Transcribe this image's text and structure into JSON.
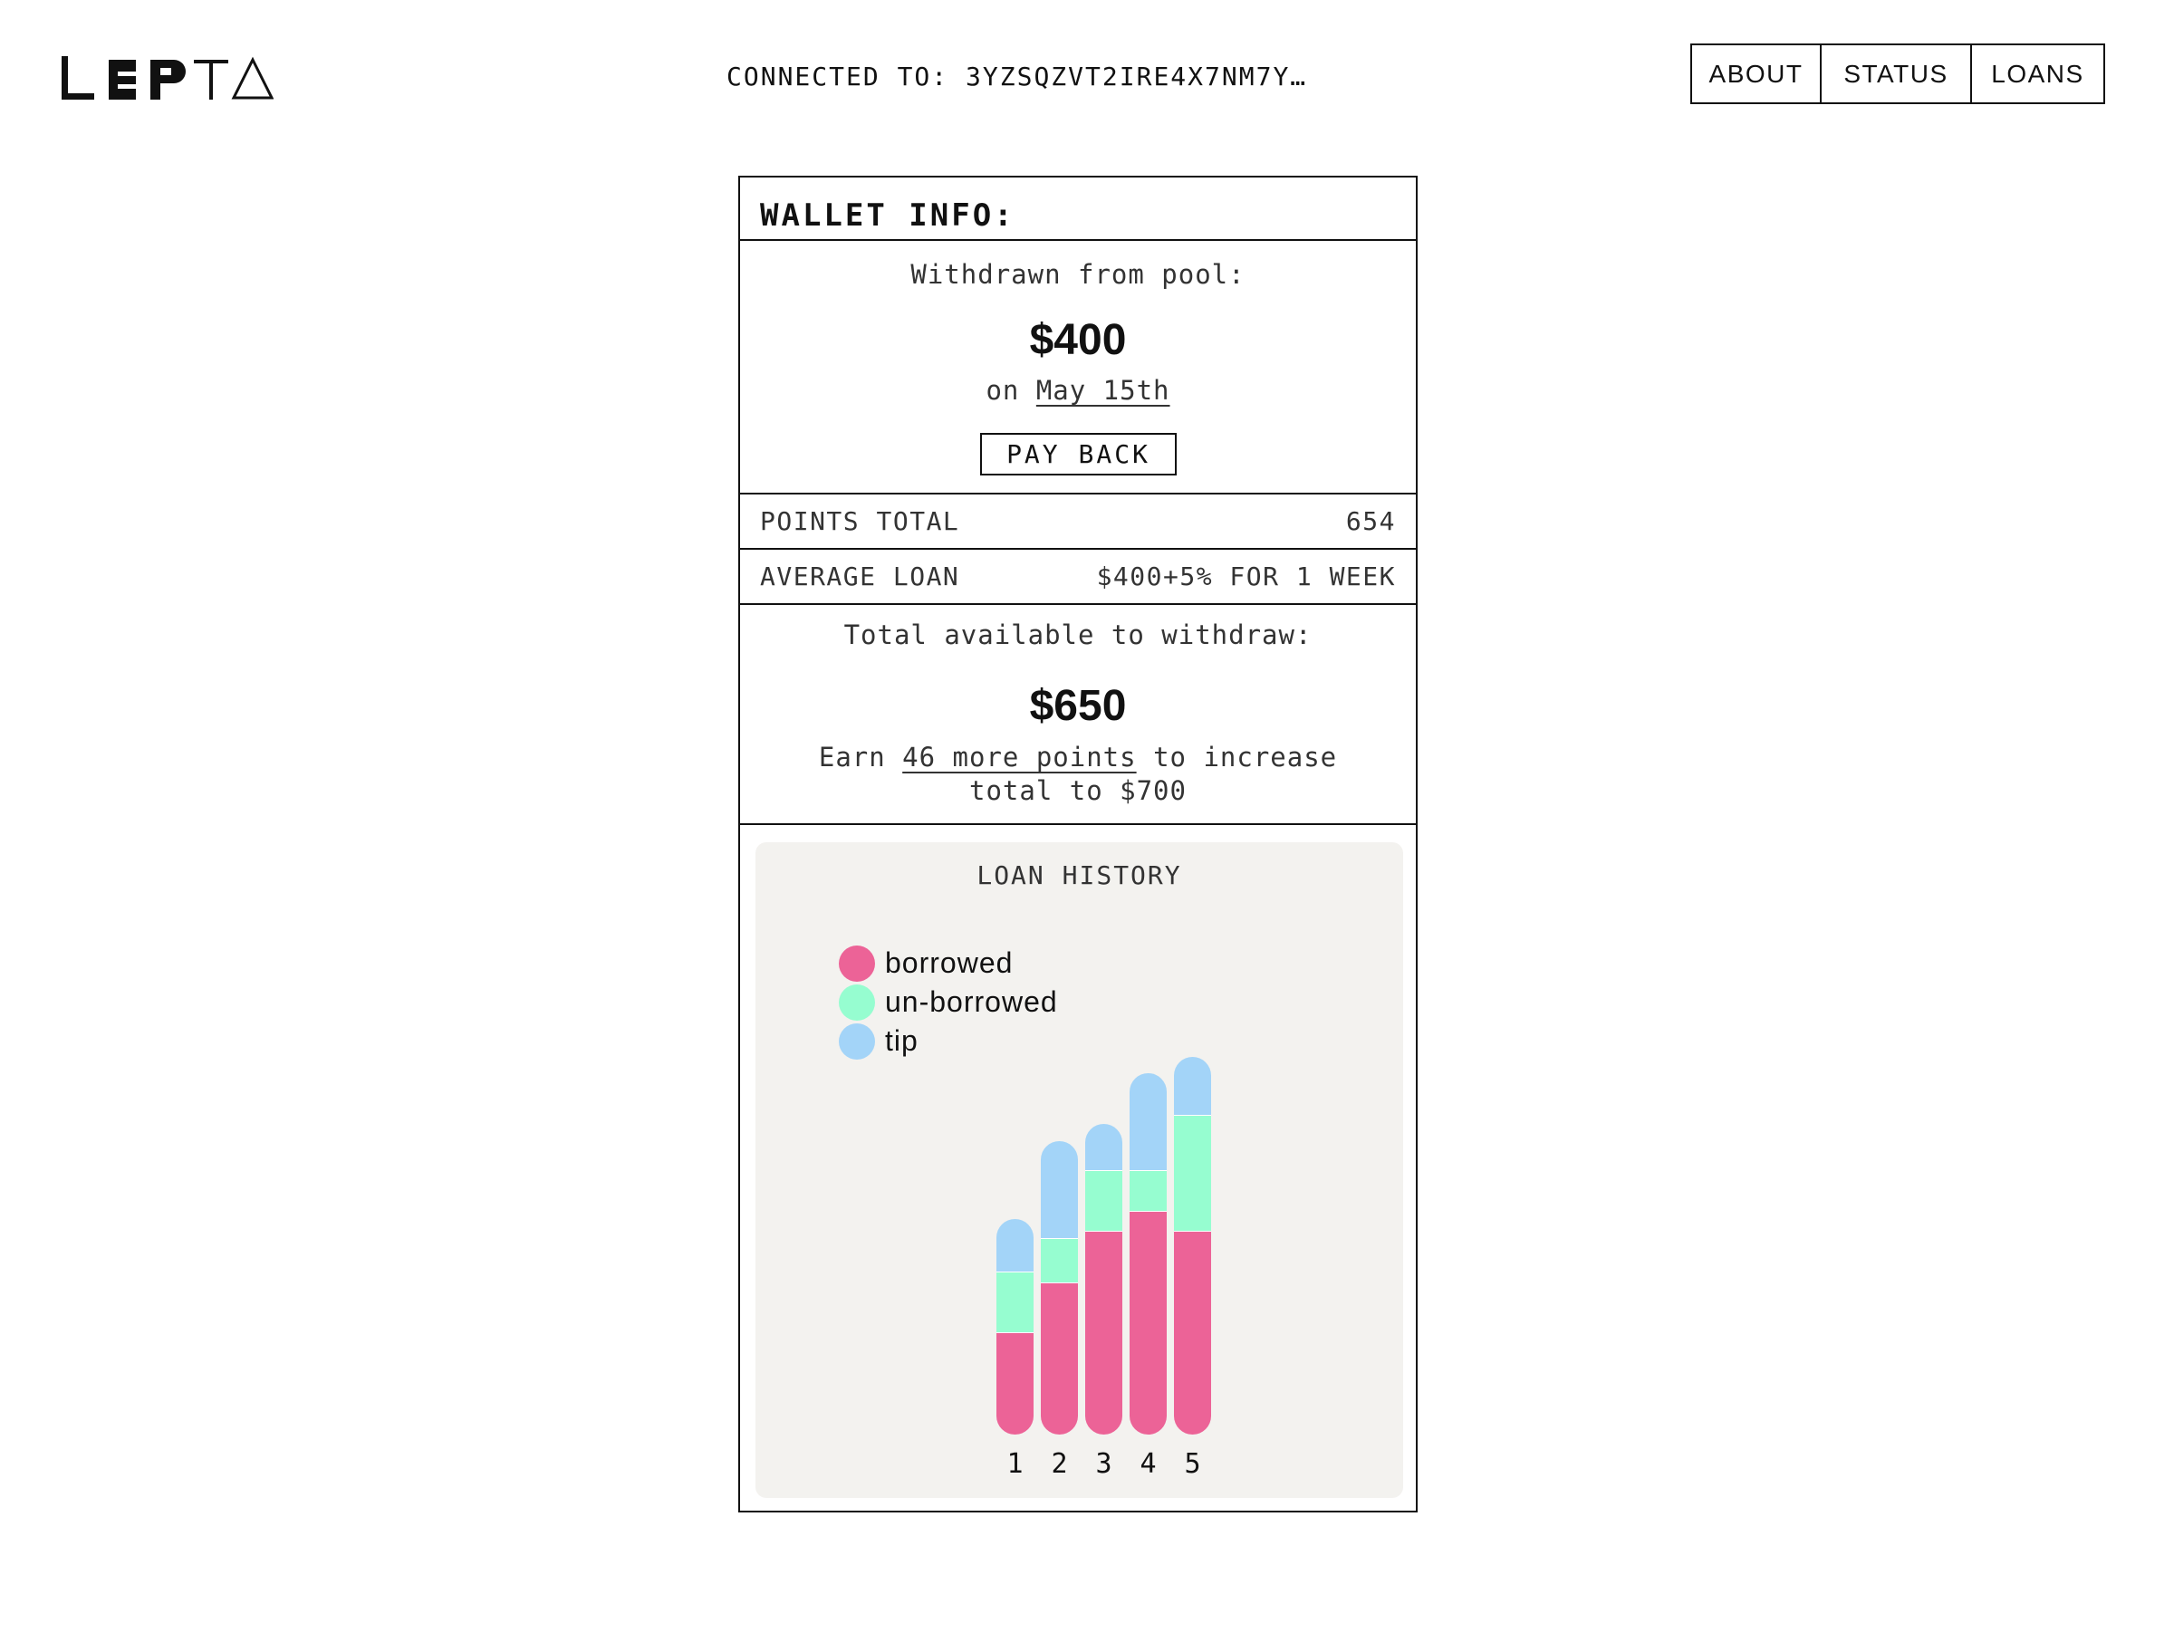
{
  "header": {
    "logo_text": "LEPTA",
    "connected_label": "CONNECTED TO:",
    "connected_address": "3YZSQZVT2IRE4X7NM7Y…",
    "nav": [
      {
        "label": "ABOUT"
      },
      {
        "label": "STATUS"
      },
      {
        "label": "LOANS"
      }
    ]
  },
  "wallet": {
    "title": "WALLET INFO:",
    "withdrawn": {
      "label": "Withdrawn from pool:",
      "amount": "$400",
      "date_prefix": "on",
      "date": "May 15th",
      "payback_label": "PAY BACK"
    },
    "rows": [
      {
        "label": "POINTS TOTAL",
        "value": "654"
      },
      {
        "label": "AVERAGE LOAN",
        "value": "$400+5% FOR 1 WEEK"
      }
    ],
    "available": {
      "label": "Total available to withdraw:",
      "amount": "$650",
      "earn_prefix": "Earn",
      "earn_link": "46 more points",
      "earn_suffix": "to increase total to $700"
    }
  },
  "loan_history": {
    "title": "LOAN HISTORY",
    "legend": [
      {
        "label": "borrowed",
        "color": "#ec6397"
      },
      {
        "label": "un-borrowed",
        "color": "#96fdd0"
      },
      {
        "label": "tip",
        "color": "#a3d4f8"
      }
    ]
  },
  "chart_data": {
    "type": "bar",
    "stacked": true,
    "title": "LOAN HISTORY",
    "categories": [
      "1",
      "2",
      "3",
      "4",
      "5"
    ],
    "series": [
      {
        "name": "borrowed",
        "color": "#ec6397",
        "values": [
          113,
          168,
          225,
          247,
          225
        ]
      },
      {
        "name": "un-borrowed",
        "color": "#96fdd0",
        "values": [
          67,
          49,
          67,
          45,
          128
        ]
      },
      {
        "name": "tip",
        "color": "#a3d4f8",
        "values": [
          58,
          107,
          51,
          107,
          64
        ]
      }
    ],
    "legend_position": "top-left",
    "axes_shown": false,
    "grid": false
  }
}
